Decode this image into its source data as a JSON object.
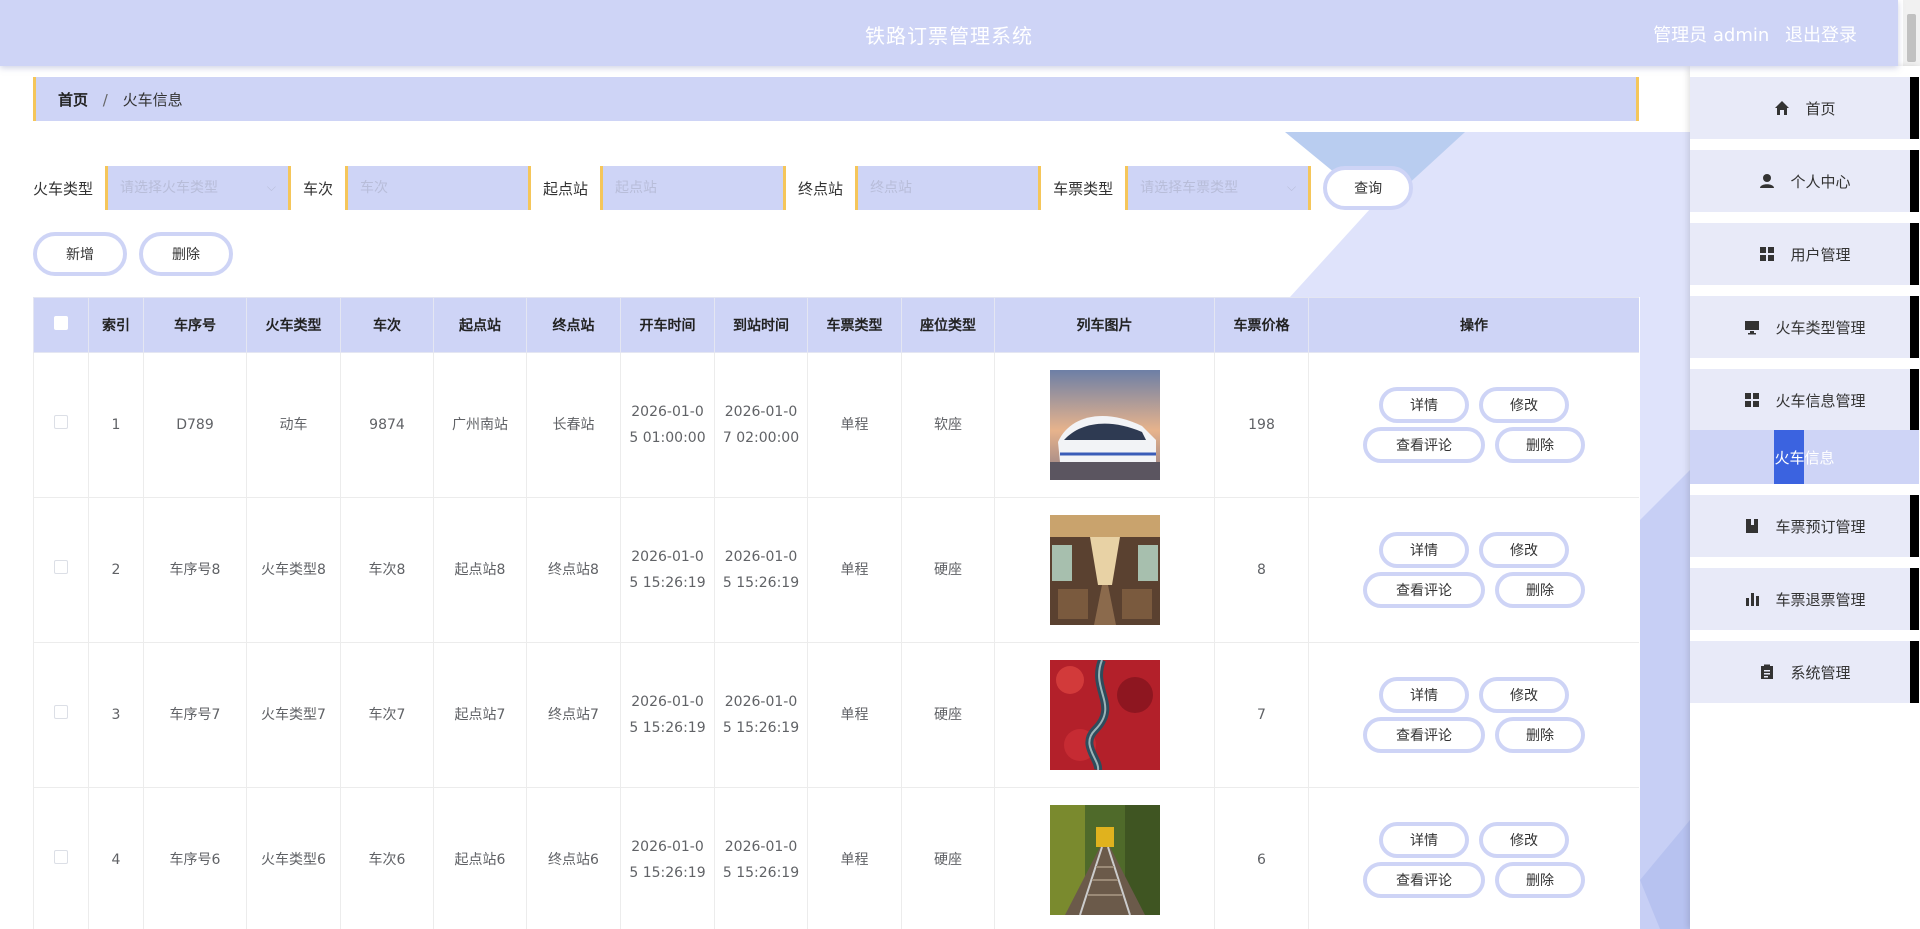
{
  "header": {
    "title": "铁路订票管理系统",
    "user_label": "管理员 admin",
    "logout_label": "退出登录"
  },
  "breadcrumb": {
    "home": "首页",
    "separator": "/",
    "current": "火车信息"
  },
  "search": {
    "train_type_label": "火车类型",
    "train_type_placeholder": "请选择火车类型",
    "train_no_label": "车次",
    "train_no_placeholder": "车次",
    "start_label": "起点站",
    "start_placeholder": "起点站",
    "end_label": "终点站",
    "end_placeholder": "终点站",
    "ticket_type_label": "车票类型",
    "ticket_type_placeholder": "请选择车票类型",
    "query_label": "查询"
  },
  "actions": {
    "add_label": "新增",
    "delete_label": "删除"
  },
  "table": {
    "columns": [
      "",
      "索引",
      "车序号",
      "火车类型",
      "车次",
      "起点站",
      "终点站",
      "开车时间",
      "到站时间",
      "车票类型",
      "座位类型",
      "列车图片",
      "车票价格",
      "操作"
    ],
    "rows": [
      {
        "index": "1",
        "serial": "D789",
        "train_type": "动车",
        "train_no": "9874",
        "start": "广州南站",
        "end": "长春站",
        "depart": "2026-01-05 01:00:00",
        "arrive": "2026-01-07 02:00:00",
        "ticket_type": "单程",
        "seat_type": "软座",
        "image": "high-speed-train-photo",
        "price": "198"
      },
      {
        "index": "2",
        "serial": "车序号8",
        "train_type": "火车类型8",
        "train_no": "车次8",
        "start": "起点站8",
        "end": "终点站8",
        "depart": "2026-01-05 15:26:19",
        "arrive": "2026-01-05 15:26:19",
        "ticket_type": "单程",
        "seat_type": "硬座",
        "image": "train-interior-photo",
        "price": "8"
      },
      {
        "index": "3",
        "serial": "车序号7",
        "train_type": "火车类型7",
        "train_no": "车次7",
        "start": "起点站7",
        "end": "终点站7",
        "depart": "2026-01-05 15:26:19",
        "arrive": "2026-01-05 15:26:19",
        "ticket_type": "单程",
        "seat_type": "硬座",
        "image": "red-landscape-photo",
        "price": "7"
      },
      {
        "index": "4",
        "serial": "车序号6",
        "train_type": "火车类型6",
        "train_no": "车次6",
        "start": "起点站6",
        "end": "终点站6",
        "depart": "2026-01-05 15:26:19",
        "arrive": "2026-01-05 15:26:19",
        "ticket_type": "单程",
        "seat_type": "硬座",
        "image": "forest-railway-photo",
        "price": "6"
      }
    ],
    "row_actions": {
      "detail": "详情",
      "edit": "修改",
      "comments": "查看评论",
      "delete": "删除"
    }
  },
  "sidebar": {
    "items": [
      {
        "label": "首页",
        "icon": "home-icon"
      },
      {
        "label": "个人中心",
        "icon": "user-icon"
      },
      {
        "label": "用户管理",
        "icon": "grid-icon"
      },
      {
        "label": "火车类型管理",
        "icon": "monitor-icon"
      },
      {
        "label": "火车信息管理",
        "icon": "grid-icon"
      },
      {
        "label": "车票预订管理",
        "icon": "book-icon"
      },
      {
        "label": "车票退票管理",
        "icon": "bar-chart-icon"
      },
      {
        "label": "系统管理",
        "icon": "clipboard-icon"
      }
    ],
    "active_sub": "火车信息"
  },
  "colors": {
    "primary": "#ced4f6",
    "accent": "#f5c65a",
    "highlight": "#3b63e0"
  }
}
